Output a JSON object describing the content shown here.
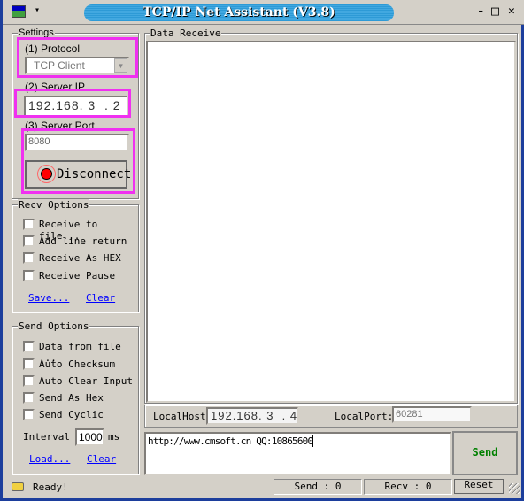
{
  "window": {
    "title": "TCP/IP Net Assistant (V3.8)",
    "min": "-",
    "max": "□",
    "close": "✕",
    "menu_arrow": "▾"
  },
  "settings": {
    "label": "Settings",
    "protocol_label": "(1) Protocol",
    "protocol_value": "TCP Client",
    "server_ip_label": "(2) Server IP",
    "server_ip": "192.168. 3  . 2",
    "server_port_label": "(3) Server Port",
    "server_port": "8080",
    "connect_button": "Disconnect",
    "highlight_color": "#f030f0",
    "led_color": "#ff0000"
  },
  "recv_options": {
    "label": "Recv Options",
    "items": [
      "Receive to file...",
      "Add line return",
      "Receive As HEX",
      "Receive Pause"
    ],
    "save": "Save...",
    "clear": "Clear"
  },
  "send_options": {
    "label": "Send Options",
    "items": [
      "Data from file ...",
      "Auto Checksum",
      "Auto Clear Input",
      "Send As Hex",
      "Send Cyclic"
    ],
    "interval_label": "Interval",
    "interval_value": "1000",
    "interval_unit": "ms",
    "load": "Load...",
    "clear": "Clear"
  },
  "receive": {
    "label": "Data Receive",
    "content": ""
  },
  "local": {
    "host_label": "LocalHost:",
    "host": "192.168. 3  . 4",
    "port_label": "LocalPort:",
    "port": "60281"
  },
  "send": {
    "text": "http://www.cmsoft.cn QQ:10865600",
    "button": "Send",
    "button_color": "#008000"
  },
  "status": {
    "text": "Ready!",
    "send_count": "Send : 0",
    "recv_count": "Recv : 0",
    "reset": "Reset"
  }
}
